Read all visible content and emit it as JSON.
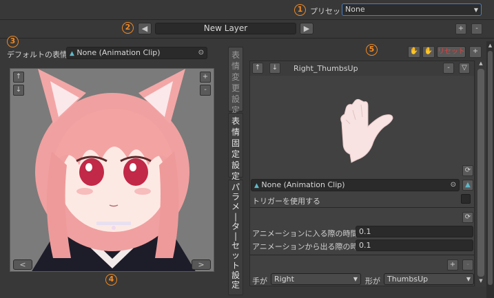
{
  "top": {
    "marker": "1",
    "preset_label": "プリセット",
    "preset_value": "None"
  },
  "layer": {
    "marker": "2",
    "prev_glyph": "◀",
    "name": "New Layer",
    "next_glyph": "▶",
    "add_glyph": "+",
    "remove_glyph": "-"
  },
  "default_expr": {
    "marker": "3",
    "label": "デフォルトの表情",
    "value": "None (Animation Clip)"
  },
  "preview": {
    "up_glyph": "↑",
    "down_glyph": "↓",
    "plus_glyph": "+",
    "minus_glyph": "-",
    "prev_glyph": "<",
    "next_glyph": ">",
    "marker": "4"
  },
  "tabs": [
    {
      "chars": [
        "表",
        "情",
        "変",
        "更",
        "設",
        "定"
      ],
      "active": false
    },
    {
      "chars": [
        "表",
        "情",
        "固",
        "定",
        "設",
        "定"
      ],
      "active": true
    },
    {
      "chars": [
        "パ",
        "ラ",
        "メ",
        "|",
        "タ",
        "|",
        "セ",
        "ッ",
        "ト",
        "設",
        "定"
      ],
      "active": false
    }
  ],
  "right": {
    "marker": "5",
    "reset_label": "リセット",
    "add_glyph": "+",
    "card": {
      "up_glyph": "↑",
      "down_glyph": "↓",
      "title": "Right_ThumbsUp",
      "minus_glyph": "-",
      "collapse_glyph": "▽",
      "clip_value": "None (Animation Clip)",
      "trigger_label": "トリガーを使用する",
      "enter_label": "アニメーションに入る際の時間",
      "enter_value": "0.1",
      "exit_label": "アニメーションから出る際の時間",
      "exit_value": "0.1",
      "hand_label": "手が",
      "hand_value": "Right",
      "shape_label": "形が",
      "shape_value": "ThumbsUp",
      "plus_glyph": "+",
      "minus2_glyph": "-"
    }
  },
  "colors": {
    "accent": "#f08a24",
    "reset": "#e04040"
  }
}
